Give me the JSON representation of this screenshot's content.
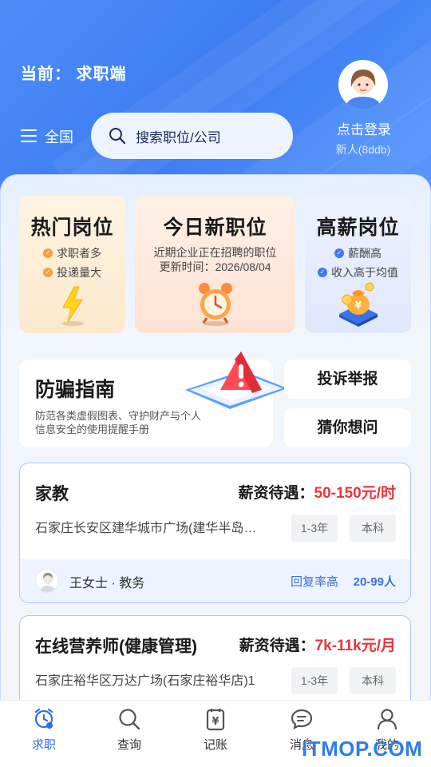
{
  "header": {
    "mode_label": "当前： 求职端",
    "region": "全国",
    "search_placeholder": "搜索职位/公司",
    "login_label": "点击登录",
    "user_id": "新人(8ddb)"
  },
  "feature_cards": [
    {
      "title": "热门岗位",
      "bullets": [
        "求职者多",
        "投递量大"
      ],
      "icon": "lightning-icon"
    },
    {
      "title": "今日新职位",
      "lines": [
        "近期企业正在招聘的职位",
        "更新时间：2026/08/04"
      ],
      "icon": "alarm-clock-icon"
    },
    {
      "title": "高薪岗位",
      "bullets": [
        "薪酬高",
        "收入高于均值"
      ],
      "icon": "money-bag-icon"
    }
  ],
  "guide": {
    "title": "防骗指南",
    "description": "防范各类虚假图表、守护财产与个人信息安全的使用提醒手册",
    "icon": "warning-icon"
  },
  "side_buttons": {
    "complaint": "投诉举报",
    "faq": "猜你想问"
  },
  "jobs": [
    {
      "title": "家教",
      "salary_label": "薪资待遇：",
      "salary": "50-150元/时",
      "address": "石家庄长安区建华城市广场(建华半岛…",
      "tags": [
        "1-3年",
        "本科"
      ],
      "recruiter": "王女士 · 教务",
      "reply": "回复率高",
      "size": "20-99人"
    },
    {
      "title": "在线营养师(健康管理)",
      "salary_label": "薪资待遇：",
      "salary": "7k-11k元/月",
      "address": "石家庄裕华区万达广场(石家庄裕华店)1",
      "tags": [
        "1-3年",
        "本科"
      ]
    }
  ],
  "tabs": [
    {
      "label": "求职",
      "icon": "job-search-icon",
      "active": true
    },
    {
      "label": "查询",
      "icon": "search-icon",
      "active": false
    },
    {
      "label": "记账",
      "icon": "ledger-icon",
      "active": false
    },
    {
      "label": "消息",
      "icon": "chat-icon",
      "active": false
    },
    {
      "label": "我的",
      "icon": "user-icon",
      "active": false
    }
  ],
  "watermark": "ITMOP.COM",
  "colors": {
    "primary": "#3b7cf2",
    "salary": "#f0323c",
    "active_tab": "#2d6ef0"
  }
}
